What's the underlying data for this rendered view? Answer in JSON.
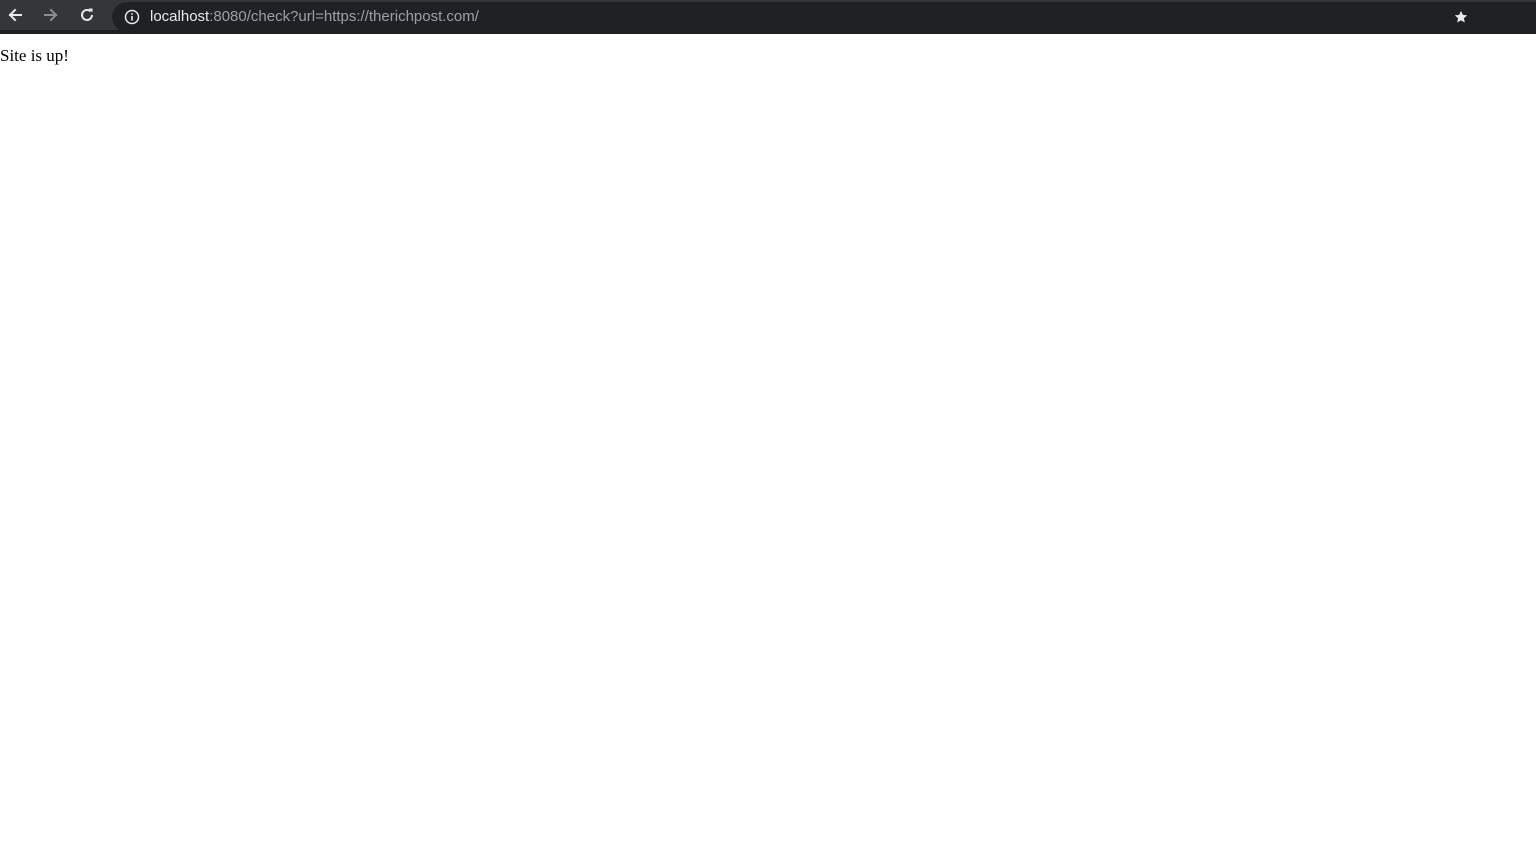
{
  "browser": {
    "address_bar": {
      "host": "localhost",
      "path": ":8080/check?url=https://therichpost.com/"
    },
    "icons": {
      "back": "arrow-left-icon",
      "forward": "arrow-right-icon",
      "reload": "reload-icon",
      "site_info": "info-circle-icon",
      "bookmark": "star-icon"
    },
    "colors": {
      "toolbar": "#35363a",
      "omnibox": "#202124",
      "url_host": "#e8eaed",
      "url_path": "#9aa0a6"
    }
  },
  "page": {
    "message": "Site is up!"
  }
}
